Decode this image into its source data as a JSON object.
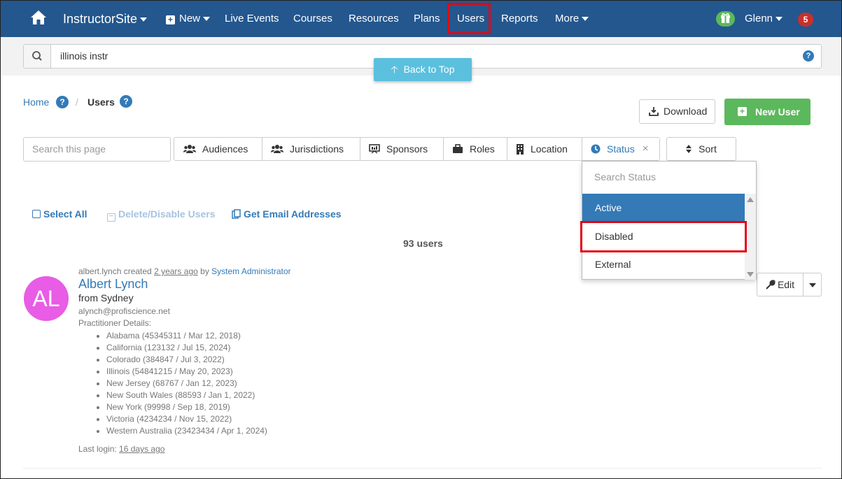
{
  "nav": {
    "brand": "InstructorSite",
    "new": "New",
    "items": [
      "Live Events",
      "Courses",
      "Resources",
      "Plans",
      "Users",
      "Reports"
    ],
    "more": "More",
    "user": "Glenn",
    "notifications": "5"
  },
  "search": {
    "value": "illinois instr",
    "help": "?"
  },
  "back_to_top": "Back to Top",
  "breadcrumb": {
    "home": "Home",
    "sep": "/",
    "current": "Users",
    "help": "?"
  },
  "actions": {
    "download": "Download",
    "new_user": "New User"
  },
  "filters": {
    "search_placeholder": "Search this page",
    "buttons": [
      "Audiences",
      "Jurisdictions",
      "Sponsors",
      "Roles",
      "Location",
      "Status"
    ],
    "clear": "×",
    "sort": "Sort"
  },
  "status_dropdown": {
    "search_placeholder": "Search Status",
    "options": [
      "Active",
      "Disabled",
      "External"
    ],
    "selected": "Active"
  },
  "bulk": {
    "select_all": "Select All",
    "delete_disable": "Delete/Disable Users",
    "get_emails": "Get Email Addresses"
  },
  "user_count": "93 users",
  "user": {
    "initials": "AL",
    "created_by_prefix": "albert.lynch created",
    "created_ago": "2 years ago",
    "by": "by",
    "created_by": "System Administrator",
    "name": "Albert Lynch",
    "from": "from Sydney",
    "email": "alynch@profiscience.net",
    "details_label": "Practitioner Details:",
    "details": [
      "Alabama (45345311 / Mar 12, 2018)",
      "California (123132 / Jul 15, 2024)",
      "Colorado (384847 / Jul 3, 2022)",
      "Illinois (54841215 / May 20, 2023)",
      "New Jersey (68767 / Jan 12, 2023)",
      "New South Wales (88593 / Jan 1, 2022)",
      "New York (99998 / Sep 18, 2019)",
      "Victoria (4234234 / Nov 15, 2022)",
      "Western Australia (23423434 / Apr 1, 2024)"
    ],
    "last_login_label": "Last login:",
    "last_login": "16 days ago",
    "edit": "Edit"
  }
}
